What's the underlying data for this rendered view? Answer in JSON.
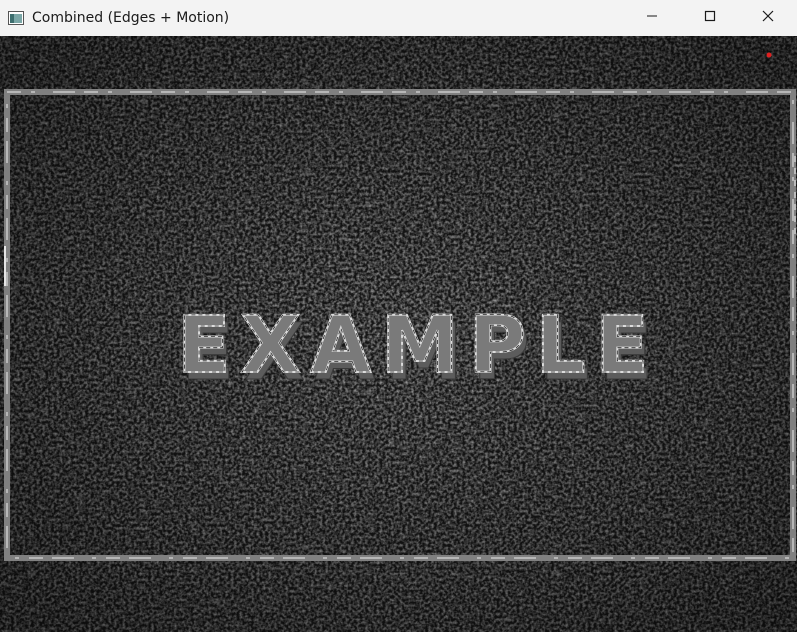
{
  "window": {
    "title": "Combined (Edges + Motion)",
    "icons": {
      "app": "app-window-icon",
      "minimize": "minimize-icon",
      "maximize": "maximize-icon",
      "close": "close-icon"
    }
  },
  "view": {
    "image_text": "EXAMPLE",
    "colors": {
      "background": "#161616",
      "edge": "#7a7a7a",
      "highlight": "#d8d8d8",
      "marker": "#e02020"
    }
  }
}
